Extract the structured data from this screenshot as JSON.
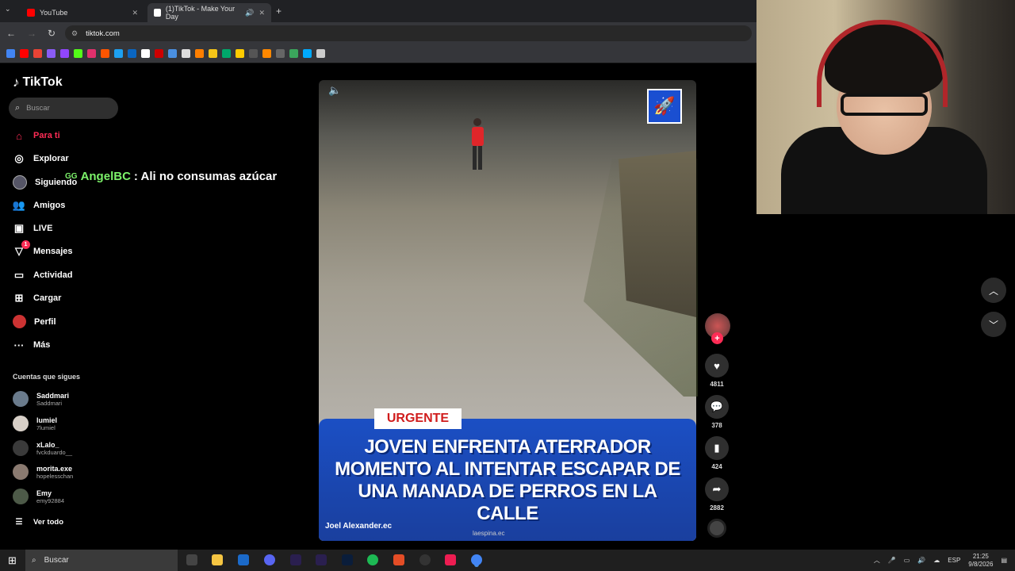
{
  "browser": {
    "tabs": [
      {
        "label": "YouTube",
        "active": false,
        "favicon_color": "#ff0000"
      },
      {
        "label": "(1)TikTok - Make Your Day",
        "active": true,
        "favicon_color": "#ffffff"
      }
    ],
    "url": "tiktok.com",
    "bookmark_colors": [
      "#4285f4",
      "#ff0000",
      "#ea4335",
      "#8a5cf6",
      "#9146ff",
      "#53fc18",
      "#e1306c",
      "#ff5500",
      "#1da1f2",
      "#0a66c2",
      "#ffffff",
      "#cc0000",
      "#4a90e2",
      "#dddddd",
      "#ff7f00",
      "#f5c518",
      "#00a86b",
      "#ffcc00",
      "#555555",
      "#ff8800",
      "#666666",
      "#3ba55c",
      "#00aaff",
      "#cccccc"
    ]
  },
  "tiktok": {
    "logo": "TikTok",
    "search_placeholder": "Buscar",
    "nav": [
      {
        "label": "Para ti",
        "icon": "home-icon",
        "active": true
      },
      {
        "label": "Explorar",
        "icon": "compass-icon",
        "active": false
      },
      {
        "label": "Siguiendo",
        "icon": "following-avatar-icon",
        "active": false
      },
      {
        "label": "Amigos",
        "icon": "friends-icon",
        "active": false
      },
      {
        "label": "LIVE",
        "icon": "live-icon",
        "active": false
      },
      {
        "label": "Mensajes",
        "icon": "messages-icon",
        "active": false,
        "badge": "1"
      },
      {
        "label": "Actividad",
        "icon": "activity-icon",
        "active": false
      },
      {
        "label": "Cargar",
        "icon": "upload-icon",
        "active": false
      },
      {
        "label": "Perfil",
        "icon": "profile-icon",
        "active": false
      },
      {
        "label": "Más",
        "icon": "more-icon",
        "active": false
      }
    ],
    "following_title": "Cuentas que sigues",
    "accounts": [
      {
        "name": "Saddmari",
        "handle": "Saddmari"
      },
      {
        "name": "lumiel",
        "handle": "7lumiel"
      },
      {
        "name": "xLalo_",
        "handle": "fvckduardo__"
      },
      {
        "name": "morita.exe",
        "handle": "hopelesschan"
      },
      {
        "name": "Emy",
        "handle": "emy92884"
      }
    ],
    "see_all": "Ver todo"
  },
  "chat": {
    "user": "AngelBC",
    "message": ": Ali no consumas azúcar"
  },
  "video": {
    "tag": "URGENTE",
    "headline": "JOVEN ENFRENTA ATERRADOR MOMENTO AL INTENTAR ESCAPAR DE UNA MANADA DE PERROS EN LA CALLE",
    "author": "Joel Alexander.ec",
    "credit": "laespina.ec",
    "likes": "4811",
    "comments": "378",
    "saves": "424",
    "shares": "2882"
  },
  "taskbar": {
    "search_placeholder": "Buscar",
    "language": "ESP",
    "time": "21:25",
    "date": "9/8/2026"
  }
}
